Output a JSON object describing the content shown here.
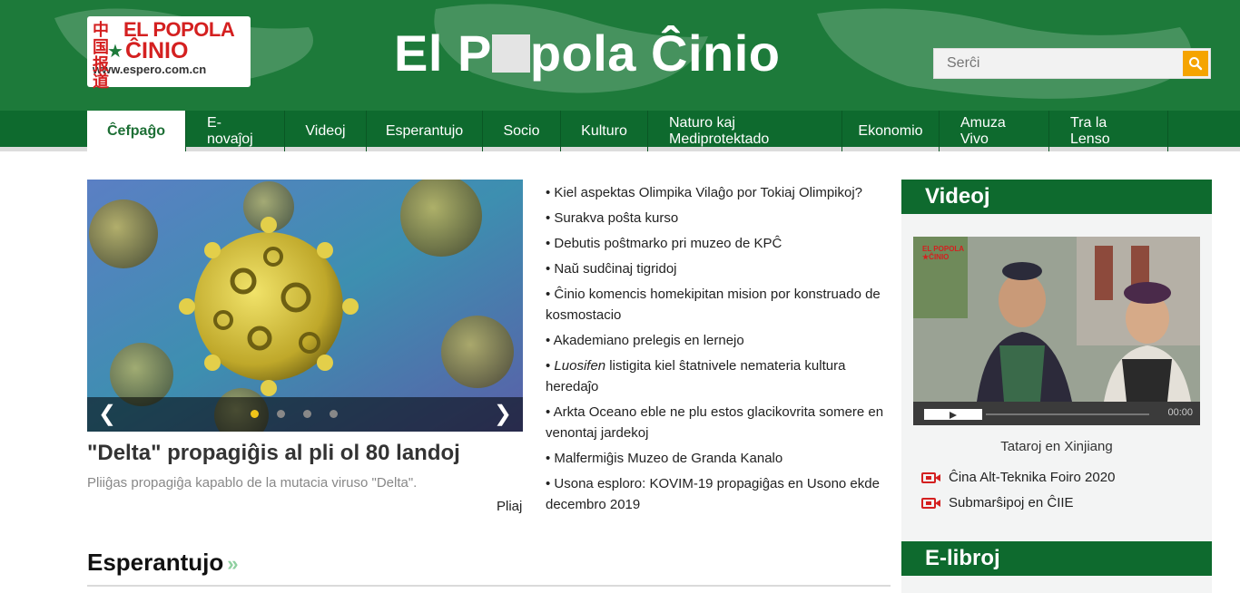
{
  "header": {
    "logo": {
      "line1": "EL POPOLA",
      "line2": "ĈINIO",
      "url": "www.espero.com.cn",
      "cn": "中国报道"
    },
    "site_title_a": "El P",
    "site_title_b": "pola Ĉinio",
    "search": {
      "placeholder": "Serĉi"
    }
  },
  "nav": {
    "items": [
      "Ĉefpaĝo",
      "E-novaĵoj",
      "Videoj",
      "Esperantujo",
      "Socio",
      "Kulturo",
      "Naturo kaj Mediprotektado",
      "Ekonomio",
      "Amuza Vivo",
      "Tra la Lenso"
    ]
  },
  "main": {
    "headline": "\"Delta\" propagiĝis al pli ol 80 landoj",
    "summary": "Pliiĝas propagiĝa kapablo de la mutacia viruso \"Delta\".",
    "more": "Pliaj"
  },
  "news": [
    {
      "text": "• Kiel aspektas Olimpika Vilaĝo por Tokiaj Olimpikoj?"
    },
    {
      "text": "• Surakva poŝta kurso"
    },
    {
      "text": "• Debutis poŝtmarko pri muzeo de KPĈ"
    },
    {
      "text": "• Naŭ sudĉinaj tigridoj"
    },
    {
      "text": "• Ĉinio komencis homekipitan mision por konstruado de kosmostacio"
    },
    {
      "text": "• Akademiano prelegis en lernejo"
    },
    {
      "prefix": "• ",
      "italic": "Luosifen",
      "rest": " listigita kiel ŝtatnivele nemateria kultura heredaĵo"
    },
    {
      "text": "• Arkta Oceano eble ne plu estos glacikovrita somere en venontaj jardekoj"
    },
    {
      "text": "• Malfermiĝis Muzeo de Granda Kanalo"
    },
    {
      "text": "• Usona esploro: KOVIM-19 propagiĝas en Usono ekde decembro 2019"
    }
  ],
  "sidebar": {
    "title": "Videoj",
    "video_time": "00:00",
    "caption": "Tataroj en Xinjiang",
    "links": [
      "Ĉina Alt-Teknika Foiro 2020",
      "Submarŝipoj en ĈIIE"
    ],
    "second_title": "E-libroj"
  },
  "section": {
    "title": "Esperantujo"
  },
  "colors": {
    "header_green": "#1d7a3a",
    "nav_green": "#0e6a2e",
    "accent_orange": "#f5a400",
    "logo_red": "#d42020"
  }
}
